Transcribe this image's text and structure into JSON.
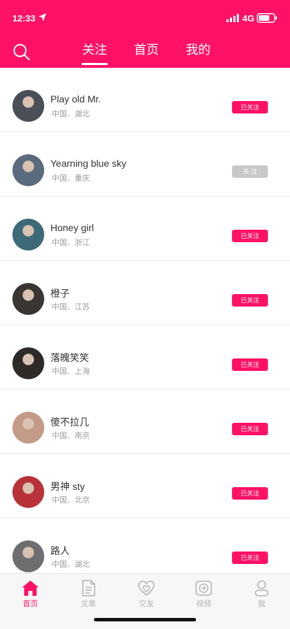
{
  "status_bar": {
    "time": "12:33",
    "network": "4G"
  },
  "header": {
    "tabs": [
      {
        "label": "关注",
        "active": true
      },
      {
        "label": "首页",
        "active": false
      },
      {
        "label": "我的",
        "active": false
      }
    ]
  },
  "users": [
    {
      "name": "Play old Mr.",
      "location": "中国．湖北",
      "status": "已关注",
      "followed": true
    },
    {
      "name": "Yearning blue sky",
      "location": "中国．重庆",
      "status": "关 注",
      "followed": false
    },
    {
      "name": "Honey girl",
      "location": "中国．浙江",
      "status": "已关注",
      "followed": true
    },
    {
      "name": "橙子",
      "location": "中国．江苏",
      "status": "已关注",
      "followed": true
    },
    {
      "name": "落魄笑笑",
      "location": "中国．上海",
      "status": "已关注",
      "followed": true
    },
    {
      "name": "傻不拉几",
      "location": "中国．南京",
      "status": "已关注",
      "followed": true
    },
    {
      "name": "男神 sty",
      "location": "中国．北京",
      "status": "已关注",
      "followed": true
    },
    {
      "name": "路人",
      "location": "中国．湖北",
      "status": "已关注",
      "followed": true
    }
  ],
  "bottom_nav": [
    {
      "label": "首页",
      "icon": "home-icon",
      "active": true
    },
    {
      "label": "文章",
      "icon": "article-icon",
      "active": false
    },
    {
      "label": "交友",
      "icon": "friends-heart-icon",
      "active": false
    },
    {
      "label": "视频",
      "icon": "video-icon",
      "active": false
    },
    {
      "label": "我",
      "icon": "profile-icon",
      "active": false
    }
  ],
  "colors": {
    "brand": "#ff1166",
    "unfollowed_button": "#c8c8c8",
    "nav_inactive": "#b4b4b4",
    "avatars": [
      "#4a4f57",
      "#5b6b7e",
      "#3e6a78",
      "#3a3632",
      "#2e2a28",
      "#c49a88",
      "#b8323a",
      "#6e6e70"
    ]
  }
}
